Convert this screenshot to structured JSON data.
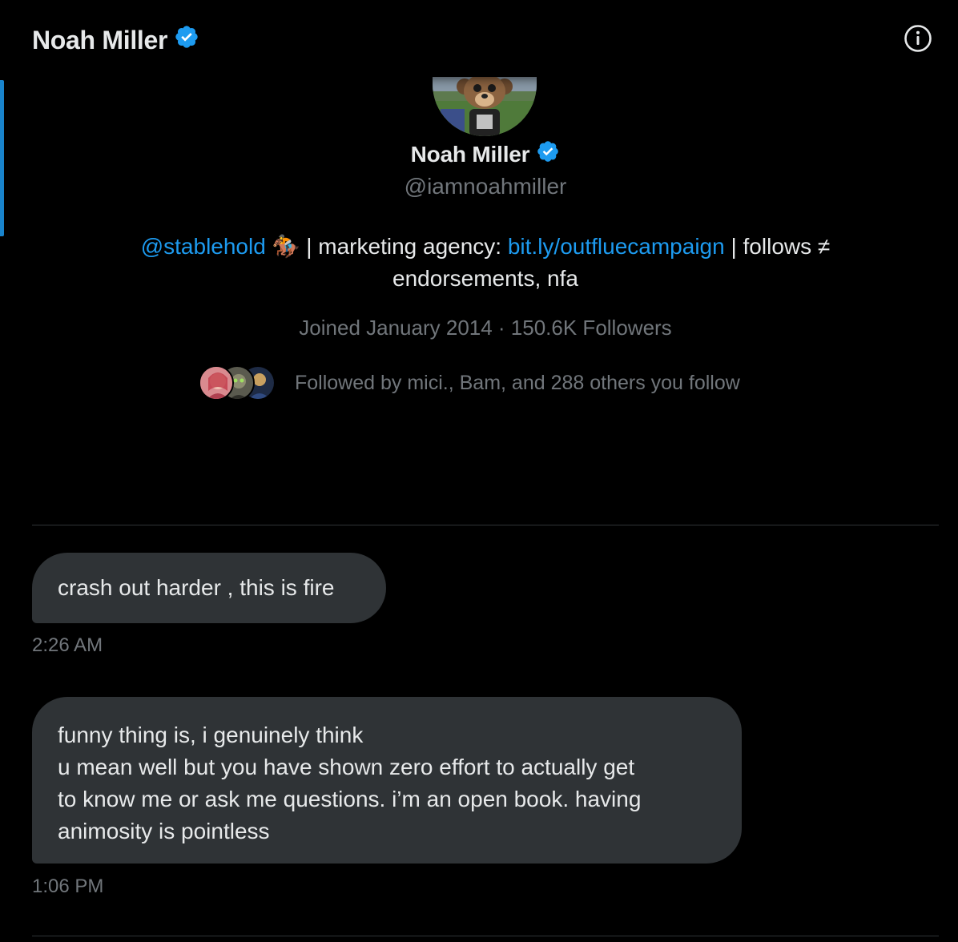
{
  "header": {
    "title": "Noah Miller",
    "verified_icon": "verified-badge-icon",
    "info_icon": "info-icon"
  },
  "profile": {
    "name": "Noah Miller",
    "handle": "@iamnoahmiller",
    "bio": {
      "mention": "@stablehold",
      "emoji": "🏇",
      "text_1": " | marketing agency: ",
      "link": "bit.ly/outfluecampaign",
      "text_2": " | follows ≠ endorsements, nfa"
    },
    "meta": "Joined January 2014 · 150.6K Followers",
    "followed_by": "Followed by mici., Bam, and 288 others you follow"
  },
  "messages": [
    {
      "lines": [
        "crash out harder , this is fire"
      ],
      "time": "2:26 AM"
    },
    {
      "lines": [
        "funny thing is, i genuinely think",
        "u mean well but you have shown zero effort to actually get",
        "to know me or ask me questions. i’m an open book. having",
        "animosity is pointless"
      ],
      "time": "1:06 PM"
    }
  ],
  "colors": {
    "background": "#000000",
    "accent": "#1d9bf0",
    "bubble": "#2f3336",
    "muted_text": "#71767b",
    "primary_text": "#e7e9ea"
  }
}
